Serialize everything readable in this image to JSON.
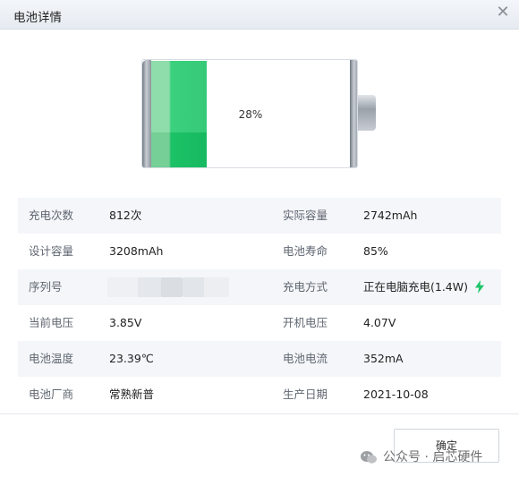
{
  "dialog": {
    "title": "电池详情",
    "close_icon": "close-icon"
  },
  "battery": {
    "percent_label": "28%",
    "level": 0.28,
    "fill_color": "#1dc468"
  },
  "rows": [
    {
      "label1": "充电次数",
      "value1": "812次",
      "label2": "实际容量",
      "value2": "2742mAh"
    },
    {
      "label1": "设计容量",
      "value1": "3208mAh",
      "label2": "电池寿命",
      "value2": "85%"
    },
    {
      "label1": "序列号",
      "value1": "",
      "label2": "充电方式",
      "value2": "正在电脑充电(1.4W)"
    },
    {
      "label1": "当前电压",
      "value1": "3.85V",
      "label2": "开机电压",
      "value2": "4.07V"
    },
    {
      "label1": "电池温度",
      "value1": "23.39℃",
      "label2": "电池电流",
      "value2": "352mA"
    },
    {
      "label1": "电池厂商",
      "value1": "常熟新普",
      "label2": "生产日期",
      "value2": "2021-10-08"
    }
  ],
  "footer": {
    "ok_label": "确定"
  },
  "watermark": {
    "text": "公众号 · 启芯硬件"
  },
  "colors": {
    "accent_green": "#1dc468",
    "row_shade": "#f4f6f9"
  }
}
